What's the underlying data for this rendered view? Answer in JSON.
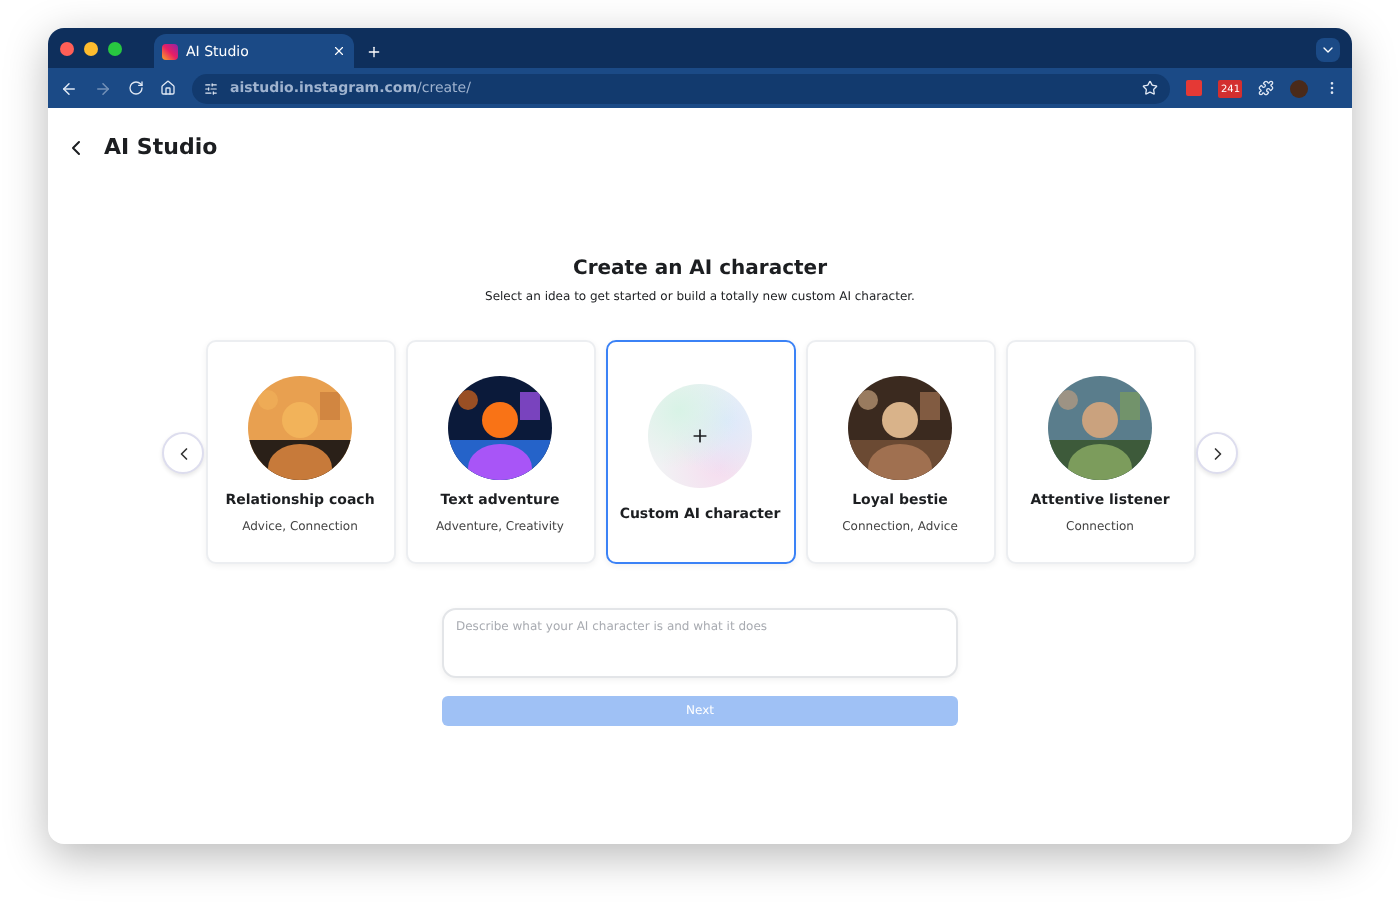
{
  "browser": {
    "tab_title": "AI Studio",
    "url": "**aistudio.instagram.com**/create/",
    "forward_disabled": true,
    "badge": "241"
  },
  "header": {
    "title": "AI Studio"
  },
  "heading": "Create an AI character",
  "subheading": "Select an idea to get started or build a totally new custom AI character.",
  "cards": [
    {
      "kind": "persona",
      "title": "Relationship coach",
      "tags": "Advice, Connection",
      "selected": false
    },
    {
      "kind": "persona",
      "title": "Text adventure",
      "tags": "Adventure, Creativity",
      "selected": false
    },
    {
      "kind": "custom",
      "title": "Custom AI character",
      "selected": true
    },
    {
      "kind": "persona",
      "title": "Loyal bestie",
      "tags": "Connection, Advice",
      "selected": false
    },
    {
      "kind": "persona",
      "title": "Attentive listener",
      "tags": "Connection",
      "selected": false
    }
  ],
  "description": {
    "placeholder": "Describe what your AI character is and what it does"
  },
  "next_button": {
    "label": "Next",
    "disabled": true
  }
}
